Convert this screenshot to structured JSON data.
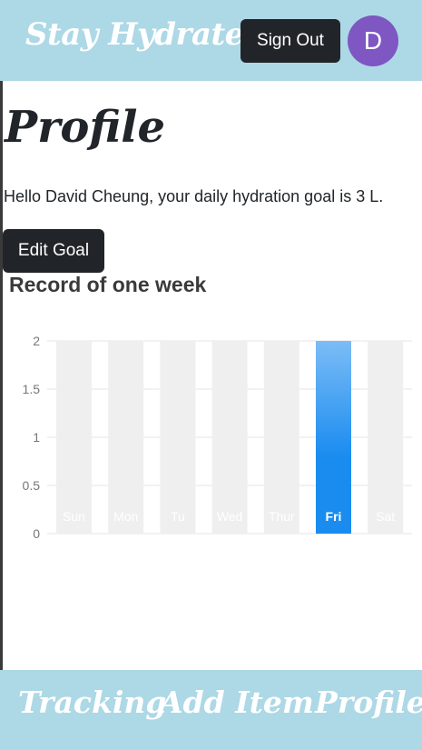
{
  "header": {
    "brand": "Stay Hydrated",
    "sign_out_label": "Sign Out",
    "avatar_initial": "D"
  },
  "main": {
    "title": "Profile",
    "greeting": "Hello David Cheung, your daily hydration goal is 3 L.",
    "edit_goal_label": "Edit Goal",
    "section_title": "Record of one week"
  },
  "chart_data": {
    "type": "bar",
    "title": "",
    "xlabel": "",
    "ylabel": "",
    "categories": [
      "Sun",
      "Mon",
      "Tu",
      "Wed",
      "Thur",
      "Fri",
      "Sat"
    ],
    "values": [
      0,
      0,
      0,
      0,
      0,
      2,
      0
    ],
    "yticks": [
      "0",
      "0.5",
      "1",
      "1.5",
      "2"
    ],
    "ylim": [
      0,
      2
    ],
    "grid": true,
    "highlighted_category": "Fri",
    "colors": {
      "background_bar": "#efefef",
      "bar_top": "#7cbcf6",
      "bar_bottom": "#1a8cf0",
      "grid": "#e6e6e6",
      "tick_label": "#777777",
      "category_label": "#ffffff"
    }
  },
  "footer": {
    "nav": [
      "Tracking",
      "Add Item",
      "Profile"
    ]
  }
}
